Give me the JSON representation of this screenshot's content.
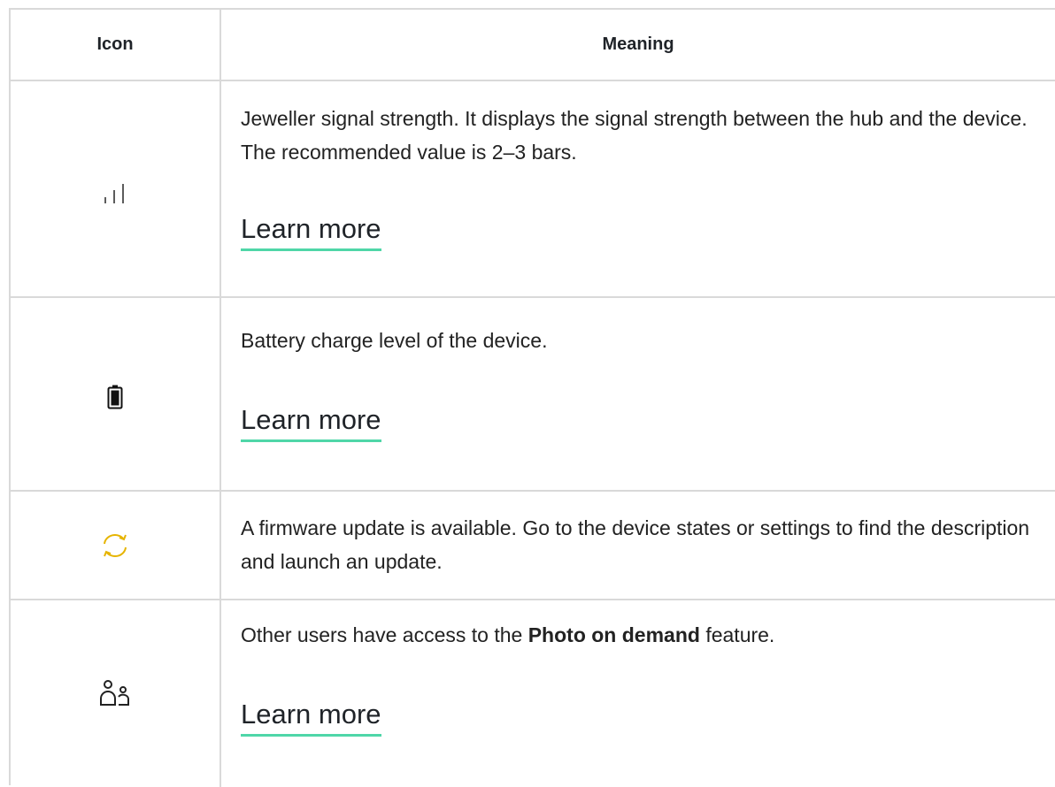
{
  "table": {
    "headers": {
      "icon": "Icon",
      "meaning": "Meaning"
    },
    "rows": [
      {
        "icon": "signal-strength-icon",
        "description": "Jeweller signal strength. It displays the signal strength between the hub and the device. The recommended value is 2–3 bars.",
        "link": "Learn more"
      },
      {
        "icon": "battery-icon",
        "description": "Battery charge level of the device.",
        "link": "Learn more"
      },
      {
        "icon": "firmware-update-icon",
        "icon_color": "#e6b400",
        "description": "A firmware update is available. Go to the device states or settings to find the description and launch an update."
      },
      {
        "icon": "shared-users-icon",
        "description_prefix": "Other users have access to the ",
        "description_bold": "Photo on demand",
        "description_suffix": " feature.",
        "link": "Learn more"
      }
    ]
  },
  "colors": {
    "border": "#d9d9d9",
    "link_underline": "#4fd6a8",
    "update_icon": "#e6b400"
  }
}
